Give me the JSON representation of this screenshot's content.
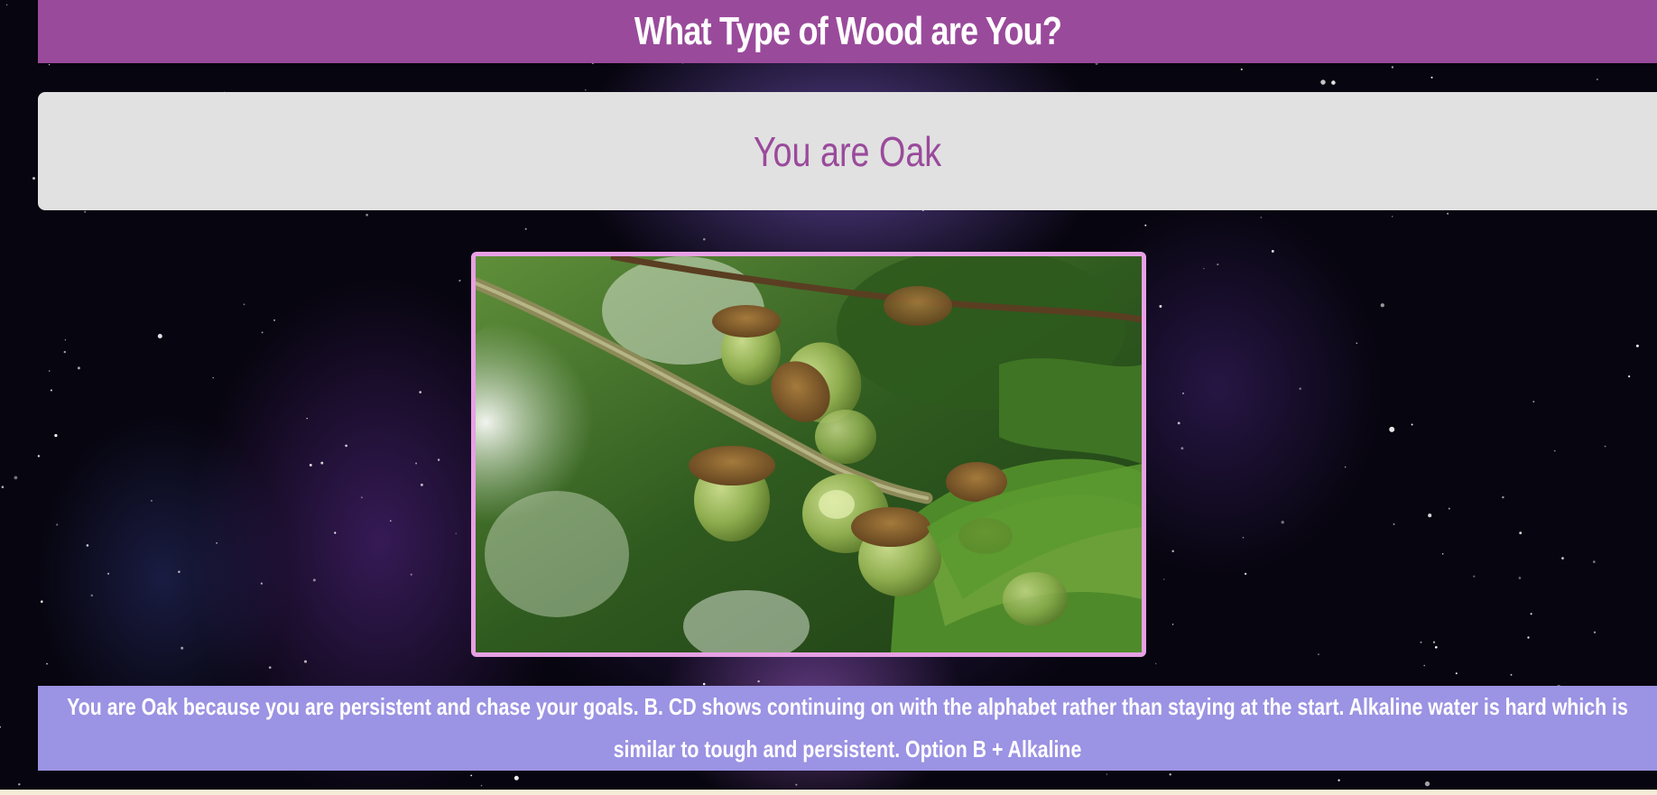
{
  "header": {
    "title": "What Type of Wood are You?"
  },
  "result": {
    "title": "You are Oak"
  },
  "image": {
    "subject": "oak acorns on a branch"
  },
  "explanation": {
    "text": "You are Oak because you are persistent and chase your goals. B. CD shows continuing on with the alphabet rather than staying at the start. Alkaline water is hard which is similar to tough and persistent. Option B + Alkaline"
  },
  "colors": {
    "header_bg": "#9a4a9b",
    "card_bg": "#e1e1e1",
    "result_text": "#9a4a9b",
    "frame_border": "#e7a0e4",
    "explanation_bg": "#9b93e3"
  }
}
